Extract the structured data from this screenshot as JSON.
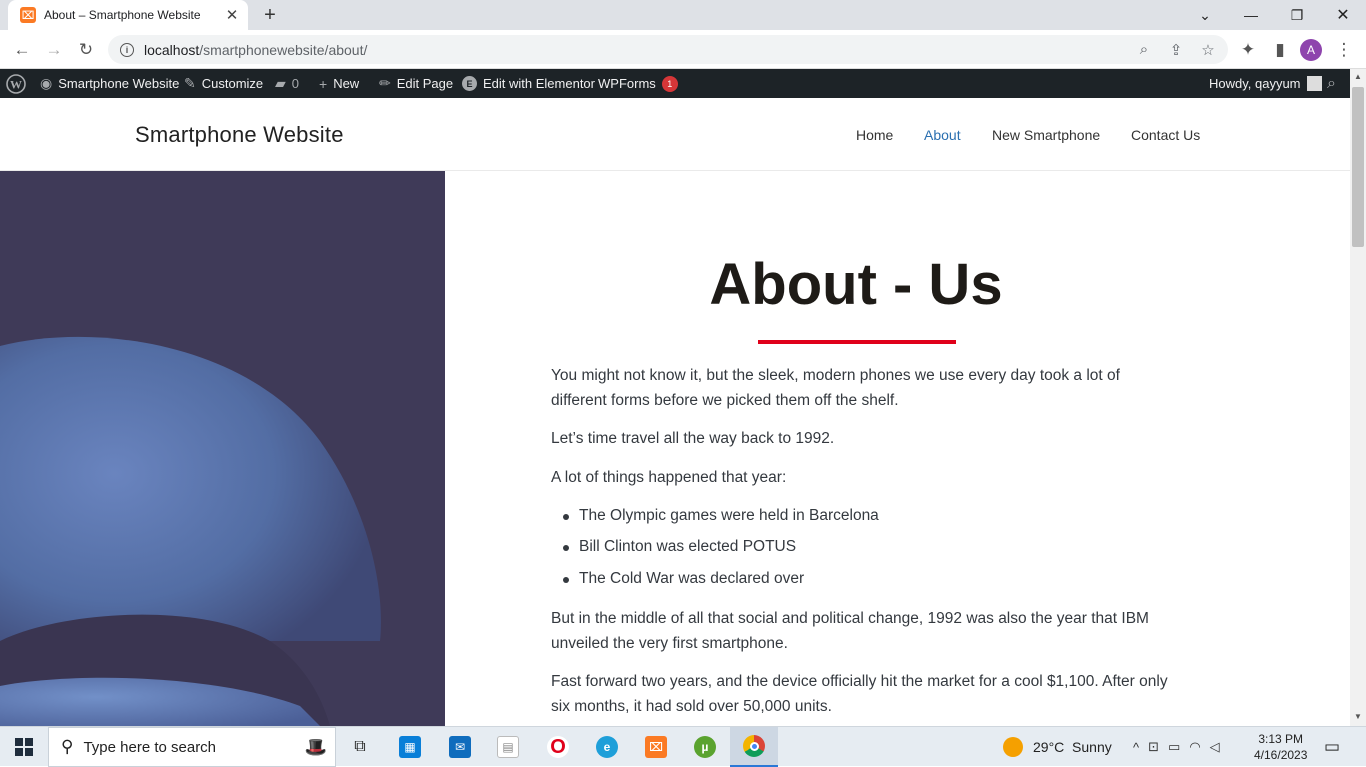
{
  "browser": {
    "tab_title": "About – Smartphone Website",
    "url_host": "localhost",
    "url_path": "/smartphonewebsite/about/"
  },
  "wp_admin_bar": {
    "site_name": "Smartphone Website",
    "customize": "Customize",
    "comments_count": "0",
    "new": "New",
    "edit_page": "Edit Page",
    "elementor": "Edit with Elementor",
    "wpforms": "WPForms",
    "wpforms_badge": "1",
    "howdy": "Howdy, qayyum"
  },
  "site": {
    "title": "Smartphone Website",
    "menu": [
      "Home",
      "About",
      "New Smartphone",
      "Contact Us"
    ],
    "active_menu": "About"
  },
  "page": {
    "heading": "About - Us",
    "paragraphs": [
      "You might not know it, but the sleek, modern phones we use every day took a lot of different forms before we picked them off the shelf.",
      "Let’s time travel all the way back to 1992.",
      "A lot of things happened that year:",
      "But in the middle of all that social and political change, 1992 was also the year that IBM unveiled the very first smartphone.",
      "Fast forward two years, and the device officially hit the market for a cool $1,100. After only six months, it had sold over 50,000 units."
    ],
    "bullets": [
      "The Olympic games were held in Barcelona",
      "Bill Clinton was elected POTUS",
      "The Cold War was declared over"
    ]
  },
  "taskbar": {
    "search_placeholder": "Type here to search",
    "weather": "29°C  Sunny",
    "time": "3:13 PM",
    "date": "4/16/2023"
  },
  "colors": {
    "accent_red": "#e0001a",
    "menu_active": "#2a6fb0",
    "admin_bar": "#1d2327",
    "hero_panel": "#3f3a58"
  }
}
